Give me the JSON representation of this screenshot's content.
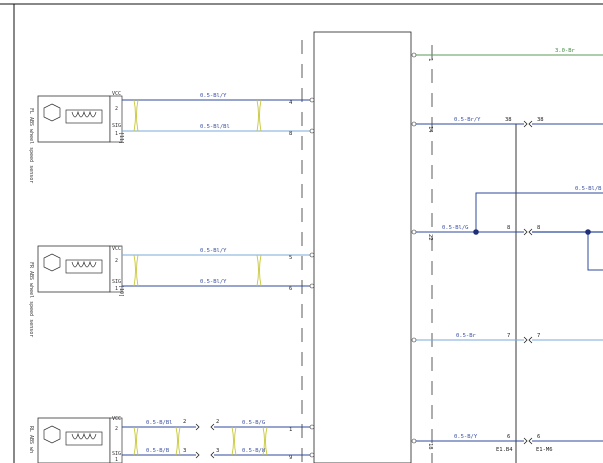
{
  "sensors": [
    {
      "id": "s1",
      "vcc_label": "VCC",
      "sig_label": "SIG",
      "pin_top": "2",
      "pin_bot": "1",
      "vert_label": "FL ABS wheel speed sensor",
      "connector_label": "[11]"
    },
    {
      "id": "s2",
      "vcc_label": "VCC",
      "sig_label": "SIG",
      "pin_top": "2",
      "pin_bot": "1",
      "vert_label": "FR ABS wheel speed sensor",
      "connector_label": "[10]"
    },
    {
      "id": "s3",
      "vcc_label": "VCC",
      "sig_label": "SIG",
      "pin_top": "2",
      "pin_bot": "1",
      "vert_label": "RL ABS wh",
      "connector_label": ""
    }
  ],
  "wires_left": [
    {
      "id": "w1",
      "label": "0.5-Bl/Y",
      "pin_right": "4"
    },
    {
      "id": "w2",
      "label": "0.5-Bl/Bl",
      "pin_right": "8"
    },
    {
      "id": "w3",
      "label": "0.5-Bl/Y",
      "pin_right": "5"
    },
    {
      "id": "w4",
      "label": "0.5-Bl/Y",
      "pin_right": "6"
    },
    {
      "id": "w5a",
      "label": "0.5-B/Bl",
      "pin_mid": "2"
    },
    {
      "id": "w5b",
      "label": "0.5-B/G",
      "pin_right": "1"
    },
    {
      "id": "w6a",
      "label": "0.5-B/B",
      "pin_mid": "3"
    },
    {
      "id": "w6b",
      "label": "0.5-B/W",
      "pin_right": "9"
    }
  ],
  "wires_right": [
    {
      "id": "r1",
      "label": "3.0-Br",
      "pin_left": "1"
    },
    {
      "id": "r2",
      "label": "0.5-Br/Y",
      "pin_left": "14",
      "pin_a": "38",
      "pin_b": "38"
    },
    {
      "id": "r3",
      "label": "0.5-Bl/B",
      "pin_left": ""
    },
    {
      "id": "r4",
      "label": "0.5-Bl/G",
      "pin_left": "22",
      "pin_a": "8",
      "pin_b": "8"
    },
    {
      "id": "r5",
      "label": "0.5-Br",
      "pin_left": "",
      "pin_a": "7",
      "pin_b": "7"
    },
    {
      "id": "r6",
      "label": "0.5-B/Y",
      "pin_left": "18",
      "pin_a": "6",
      "pin_b": "6"
    }
  ],
  "bottom": {
    "ground_label": "E1.B4",
    "module_label": "E1-M6"
  }
}
